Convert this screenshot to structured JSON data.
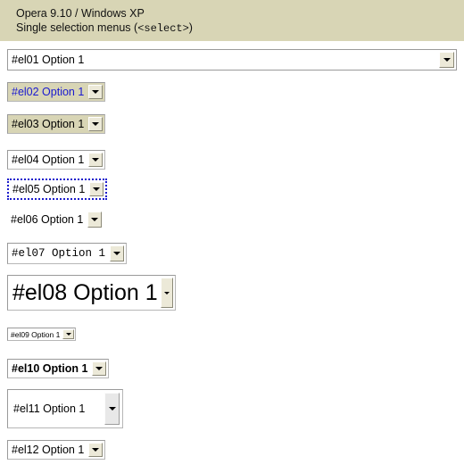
{
  "header": {
    "line1": "Opera 9.10 / Windows XP",
    "line2_prefix": "Single selection menus (",
    "line2_tag": "<select>",
    "line2_suffix": ")"
  },
  "arrow_glyph": "triangle-down",
  "selects": [
    {
      "id": "el01",
      "label": "#el01 Option 1"
    },
    {
      "id": "el02",
      "label": "#el02 Option 1"
    },
    {
      "id": "el03",
      "label": "#el03 Option 1"
    },
    {
      "id": "el04",
      "label": "#el04 Option 1"
    },
    {
      "id": "el05",
      "label": "#el05 Option 1"
    },
    {
      "id": "el06",
      "label": "#el06 Option 1"
    },
    {
      "id": "el07",
      "label": "#el07 Option 1"
    },
    {
      "id": "el08",
      "label": "#el08 Option 1"
    },
    {
      "id": "el09",
      "label": "#el09 Option 1"
    },
    {
      "id": "el10",
      "label": "#el10 Option 1"
    },
    {
      "id": "el11",
      "label": "#el11 Option 1"
    },
    {
      "id": "el12",
      "label": "#el12 Option 1"
    }
  ],
  "colors": {
    "header_bg": "#d8d5b5",
    "page_bg": "#ffffff",
    "el02_text": "#1a1ad0",
    "el02_bg": "#d8d5b5",
    "el03_bg": "#d8d5b5",
    "el05_border": "#1c1ccc",
    "button_face": "#ece9d8"
  }
}
